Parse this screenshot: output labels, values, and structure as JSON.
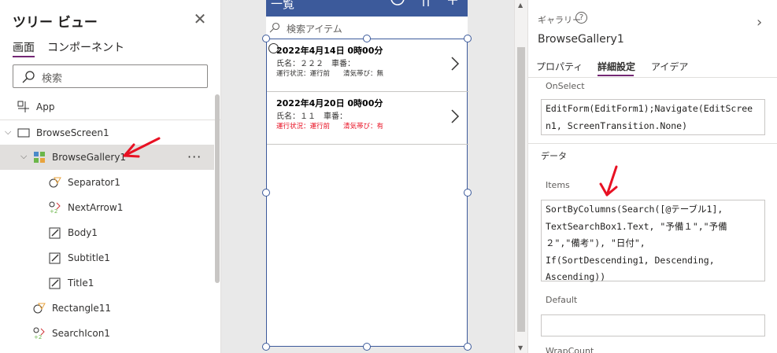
{
  "tree": {
    "title": "ツリー ビュー",
    "tabs": [
      "画面",
      "コンポーネント"
    ],
    "search_placeholder": "検索",
    "items": [
      {
        "label": "App",
        "icon": "app-icon"
      },
      {
        "label": "BrowseScreen1",
        "icon": "screen-icon"
      },
      {
        "label": "BrowseGallery1",
        "icon": "gallery-icon",
        "selected": true
      },
      {
        "label": "Separator1",
        "icon": "shape-icon"
      },
      {
        "label": "NextArrow1",
        "icon": "arrow-icon"
      },
      {
        "label": "Body1",
        "icon": "edit-label-icon"
      },
      {
        "label": "Subtitle1",
        "icon": "edit-label-icon"
      },
      {
        "label": "Title1",
        "icon": "edit-label-icon"
      },
      {
        "label": "Rectangle11",
        "icon": "shape-icon"
      },
      {
        "label": "SearchIcon1",
        "icon": "icon-control-icon"
      }
    ],
    "more_label": "···",
    "close_glyph": "✕"
  },
  "canvas": {
    "header_title": "一覧",
    "search_placeholder": "検索アイテム",
    "items": [
      {
        "title": "2022年4月14日 0時00分",
        "subtitle": "氏名：２２２　車番：",
        "body": "運行状況：運行前　　清気帯び：無",
        "body_red": false
      },
      {
        "title": "2022年4月20日 0時00分",
        "subtitle": "氏名：１１　車番：",
        "body": "運行状況：運行前　　清気帯び：有",
        "body_red": true
      }
    ]
  },
  "props": {
    "kind": "ギャラリー",
    "name": "BrowseGallery1",
    "help_glyph": "?",
    "collapse_glyph": "›",
    "tabs": [
      "プロパティ",
      "詳細設定",
      "アイデア"
    ],
    "active_tab": "詳細設定",
    "onselect_label": "OnSelect",
    "onselect_formula": "EditForm(EditForm1);Navigate(EditScree\nn1, ScreenTransition.None)",
    "data_section": "データ",
    "items_label": "Items",
    "items_formula": "SortByColumns(Search([@テーブル1],\nTextSearchBox1.Text, \"予備１\",\"予備\n２\",\"備考\"), \"日付\",\nIf(SortDescending1, Descending,\nAscending))",
    "default_label": "Default",
    "default_value": "",
    "next_label": "WrapCount"
  },
  "colors": {
    "accent": "#742774",
    "app_header": "#3c5a9b",
    "annotation": "#e81123"
  }
}
